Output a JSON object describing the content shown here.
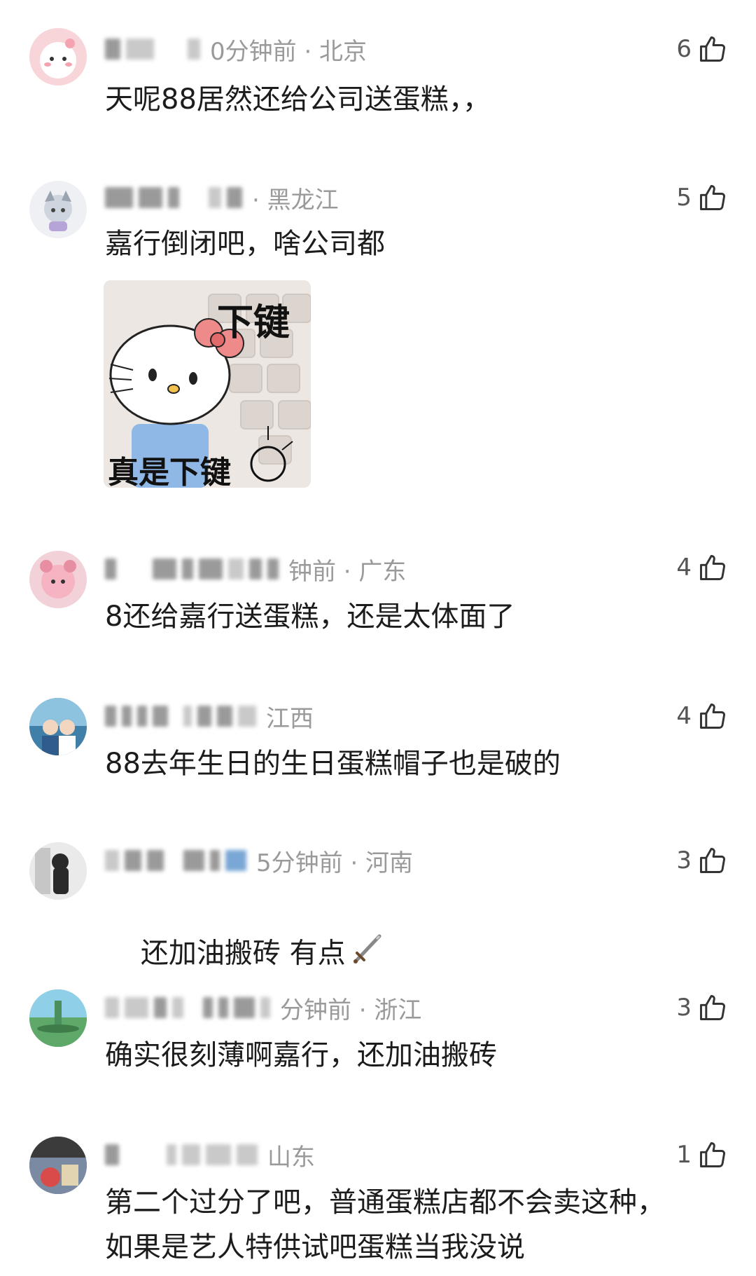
{
  "comments": [
    {
      "meta": "0分钟前 · 北京",
      "likes": "6",
      "text": "天呢88居然还给公司送蛋糕，，",
      "avatar_color": "#f7d5d8"
    },
    {
      "meta": "· 黑龙江",
      "likes": "5",
      "text": "嘉行倒闭吧，啥公司都",
      "avatar_color": "#e3e7ee",
      "sticker": {
        "top_text": "下键",
        "bottom_text": "真是下键"
      }
    },
    {
      "meta": "钟前 · 广东",
      "likes": "4",
      "text": "8还给嘉行送蛋糕，还是太体面了",
      "avatar_color": "#e9b5c0"
    },
    {
      "meta": "江西",
      "likes": "4",
      "text": "88去年生日的生日蛋糕帽子也是破的",
      "avatar_color": "#3f7fa8"
    },
    {
      "meta": "5分钟前 · 河南",
      "likes": "3",
      "text": "还加油搬砖 有点",
      "avatar_color": "#d9d9d9"
    },
    {
      "meta": "分钟前 · 浙江",
      "likes": "3",
      "text": "确实很刻薄啊嘉行，还加油搬砖",
      "avatar_color": "#6faa7a"
    },
    {
      "meta": "山东",
      "likes": "1",
      "text": "第二个过分了吧，普通蛋糕店都不会卖这种，\n如果是艺人特供试吧蛋糕当我没说",
      "avatar_color": "#5b6b85"
    }
  ],
  "icons": {
    "like": "thumbs-up-icon",
    "sword": "sword-emoji-icon"
  }
}
